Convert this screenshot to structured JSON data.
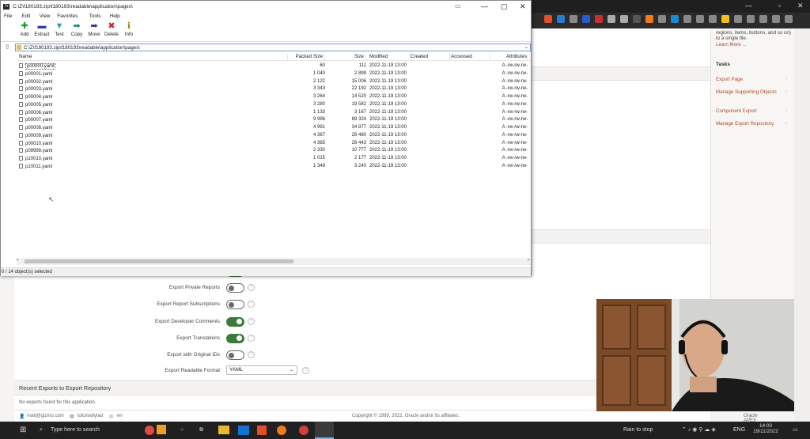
{
  "browser": {
    "extensions": [
      "brave-icon",
      "windows-icon",
      "tab-icon",
      "shield-icon",
      "red-icon",
      "g-icon",
      "record-icon",
      "dot-icon",
      "firefox-icon",
      "video-icon",
      "screen-icon",
      "star-icon",
      "speaker-icon",
      "grid-icon",
      "smiley-icon",
      "puzzle-icon",
      "panel-icon",
      "tabs-icon",
      "tablet-icon",
      "menu-icon"
    ],
    "colors": {
      "titlebar": "#1f1f1f",
      "toolbar": "#2b2b2b"
    }
  },
  "apex": {
    "side_panel": {
      "description": "regions, items, buttons, and so on) to a single file.",
      "learn_more": "Learn More ...",
      "tasks_heading": "Tasks",
      "tasks": [
        "Export Page",
        "Manage Supporting Objects",
        "Component Export",
        "Manage Export Repository"
      ]
    },
    "form": {
      "rows": [
        {
          "label": "Export Private Reports",
          "on": false
        },
        {
          "label": "Export Report Subscriptions",
          "on": false
        },
        {
          "label": "Export Developer Comments",
          "on": true
        },
        {
          "label": "Export Translations",
          "on": true
        },
        {
          "label": "Export with Original IDs",
          "on": false
        }
      ],
      "readable_format_label": "Export Readable Format",
      "readable_format_value": "YAML"
    },
    "recent_exports": {
      "heading": "Recent Exports to Export Repository",
      "empty": "No exports found for this application."
    },
    "footer": {
      "user": "matt@gizmo.com",
      "workspace": "lufcmattylad",
      "language": "en",
      "copyright": "Copyright © 1999, 2022, Oracle and/or its affiliates.",
      "version": "Oracle APEX 22.2.0-19"
    }
  },
  "zip": {
    "title": "C:\\Z\\f180193.zip\\f180193\\readable\\application\\pages\\",
    "menu": [
      "File",
      "Edit",
      "View",
      "Favorites",
      "Tools",
      "Help"
    ],
    "tools": [
      {
        "label": "Add",
        "icon": "add-icon",
        "glyph": "✚",
        "color": "#1a9a1a"
      },
      {
        "label": "Extract",
        "icon": "extract-icon",
        "glyph": "▬",
        "color": "#2a3fb0"
      },
      {
        "label": "Test",
        "icon": "test-icon",
        "glyph": "▼",
        "color": "#2aa0b0"
      },
      {
        "label": "Copy",
        "icon": "copy-icon",
        "glyph": "➡",
        "color": "#1a8a8a"
      },
      {
        "label": "Move",
        "icon": "move-icon",
        "glyph": "➡",
        "color": "#22338a"
      },
      {
        "label": "Delete",
        "icon": "delete-icon",
        "glyph": "✖",
        "color": "#d02020"
      },
      {
        "label": "Info",
        "icon": "info-icon",
        "glyph": "ℹ",
        "color": "#a08010"
      }
    ],
    "address": "C:\\Z\\f180193.zip\\f180193\\readable\\application\\pages\\",
    "columns": [
      "Name",
      "Packed Size",
      "Size",
      "Modified",
      "Created",
      "Accessed",
      "Attributes"
    ],
    "files": [
      {
        "name": "p00000.yaml",
        "packed": "60",
        "size": "111",
        "modified": "2022-11-19 13:00",
        "attr": "A -rw-rw-rw-"
      },
      {
        "name": "p00001.yaml",
        "packed": "1 040",
        "size": "2 899",
        "modified": "2022-11-19 13:00",
        "attr": "A -rw-rw-rw-"
      },
      {
        "name": "p00002.yaml",
        "packed": "2 122",
        "size": "15 006",
        "modified": "2022-11-19 13:00",
        "attr": "A -rw-rw-rw-"
      },
      {
        "name": "p00003.yaml",
        "packed": "3 343",
        "size": "22 192",
        "modified": "2022-11-19 13:00",
        "attr": "A -rw-rw-rw-"
      },
      {
        "name": "p00004.yaml",
        "packed": "3 264",
        "size": "14 520",
        "modified": "2022-11-19 13:00",
        "attr": "A -rw-rw-rw-"
      },
      {
        "name": "p00005.yaml",
        "packed": "3 280",
        "size": "19 582",
        "modified": "2022-11-19 13:00",
        "attr": "A -rw-rw-rw-"
      },
      {
        "name": "p00006.yaml",
        "packed": "1 133",
        "size": "3 167",
        "modified": "2022-11-19 13:00",
        "attr": "A -rw-rw-rw-"
      },
      {
        "name": "p00007.yaml",
        "packed": "9 996",
        "size": "89 324",
        "modified": "2022-11-19 13:00",
        "attr": "A -rw-rw-rw-"
      },
      {
        "name": "p00008.yaml",
        "packed": "4 991",
        "size": "34 877",
        "modified": "2022-11-19 13:00",
        "attr": "A -rw-rw-rw-"
      },
      {
        "name": "p00009.yaml",
        "packed": "4 367",
        "size": "28 480",
        "modified": "2022-11-19 13:00",
        "attr": "A -rw-rw-rw-"
      },
      {
        "name": "p00010.yaml",
        "packed": "4 365",
        "size": "28 443",
        "modified": "2022-11-19 13:00",
        "attr": "A -rw-rw-rw-"
      },
      {
        "name": "p09999.yaml",
        "packed": "2 330",
        "size": "10 777",
        "modified": "2022-11-19 13:00",
        "attr": "A -rw-rw-rw-"
      },
      {
        "name": "p10010.yaml",
        "packed": "1 015",
        "size": "2 177",
        "modified": "2022-11-19 13:00",
        "attr": "A -rw-rw-rw-"
      },
      {
        "name": "p10011.yaml",
        "packed": "1 349",
        "size": "3 240",
        "modified": "2022-11-19 13:00",
        "attr": "A -rw-rw-rw-"
      }
    ],
    "status": "0 / 14 object(s) selected"
  },
  "taskbar": {
    "search_placeholder": "Type here to search",
    "weather": "Rain to stop",
    "lang": "ENG",
    "time": "14:00",
    "date": "19/11/2022"
  }
}
